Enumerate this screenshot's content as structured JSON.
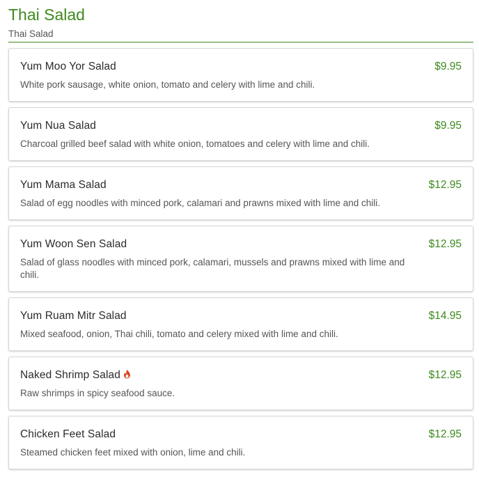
{
  "section": {
    "title": "Thai Salad",
    "subtitle": "Thai Salad"
  },
  "items": [
    {
      "name": "Yum Moo Yor Salad",
      "price": "$9.95",
      "description": "White pork sausage, white onion, tomato and celery with lime and chili.",
      "spicy": false
    },
    {
      "name": "Yum Nua Salad",
      "price": "$9.95",
      "description": "Charcoal grilled beef salad with white onion, tomatoes and celery with lime and chili.",
      "spicy": false
    },
    {
      "name": "Yum Mama Salad",
      "price": "$12.95",
      "description": "Salad of egg noodles with minced pork, calamari and prawns mixed with lime and chili.",
      "spicy": false
    },
    {
      "name": "Yum Woon Sen Salad",
      "price": "$12.95",
      "description": "Salad of glass noodles with minced pork, calamari, mussels and prawns mixed with lime and chili.",
      "spicy": false
    },
    {
      "name": "Yum Ruam Mitr Salad",
      "price": "$14.95",
      "description": "Mixed seafood, onion, Thai chili, tomato and celery mixed with lime and chili.",
      "spicy": false
    },
    {
      "name": "Naked Shrimp Salad",
      "price": "$12.95",
      "description": "Raw shrimps in spicy seafood sauce.",
      "spicy": true,
      "spicy_icon": "flame-icon"
    },
    {
      "name": "Chicken Feet Salad",
      "price": "$12.95",
      "description": "Steamed chicken feet mixed with onion, lime and chili.",
      "spicy": false
    }
  ],
  "colors": {
    "accent": "#3d8a1e",
    "flame": "#d9451b"
  }
}
